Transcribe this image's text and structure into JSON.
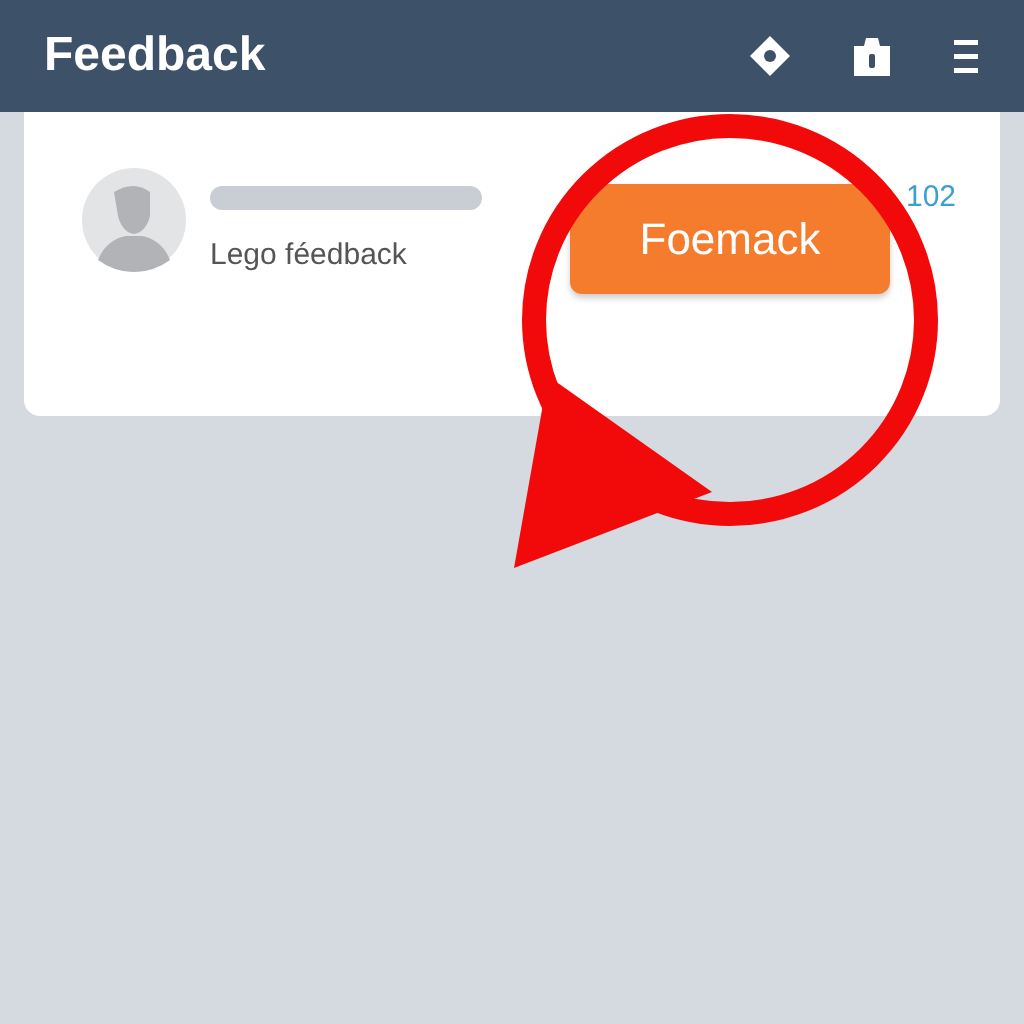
{
  "header": {
    "title": "Feedback"
  },
  "card": {
    "description": "Lego féedback",
    "button": "Foemack",
    "count": "102"
  }
}
